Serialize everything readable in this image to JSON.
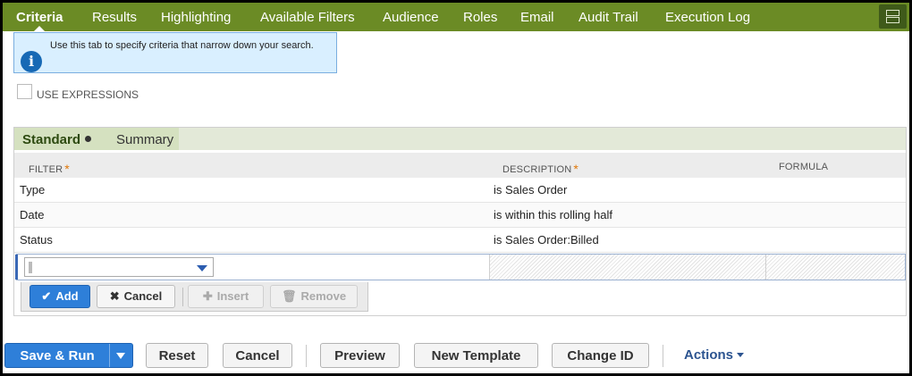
{
  "tabs": [
    {
      "label": "Criteria",
      "active": true
    },
    {
      "label": "Results"
    },
    {
      "label": "Highlighting"
    },
    {
      "label": "Available Filters"
    },
    {
      "label": "Audience"
    },
    {
      "label": "Roles"
    },
    {
      "label": "Email"
    },
    {
      "label": "Audit Trail"
    },
    {
      "label": "Execution Log"
    }
  ],
  "info": {
    "text": "Use this tab to specify criteria that narrow down your search."
  },
  "use_expressions": {
    "label": "USE EXPRESSIONS",
    "checked": false
  },
  "subtabs": {
    "standard": "Standard",
    "summary": "Summary"
  },
  "columns": {
    "filter": "FILTER",
    "description": "DESCRIPTION",
    "formula": "FORMULA",
    "required_mark": "*"
  },
  "rows": [
    {
      "filter": "Type",
      "description": "is Sales Order"
    },
    {
      "filter": "Date",
      "description": "is within this rolling half"
    },
    {
      "filter": "Status",
      "description": "is Sales Order:Billed"
    }
  ],
  "line_buttons": {
    "add": "Add",
    "cancel": "Cancel",
    "insert": "Insert",
    "remove": "Remove"
  },
  "footer": {
    "save_run": "Save & Run",
    "reset": "Reset",
    "cancel": "Cancel",
    "preview": "Preview",
    "new_template": "New Template",
    "change_id": "Change ID",
    "actions": "Actions"
  },
  "colors": {
    "tabbar": "#6b8b25",
    "primary": "#2e7fd9",
    "info_bg": "#d9efff"
  }
}
